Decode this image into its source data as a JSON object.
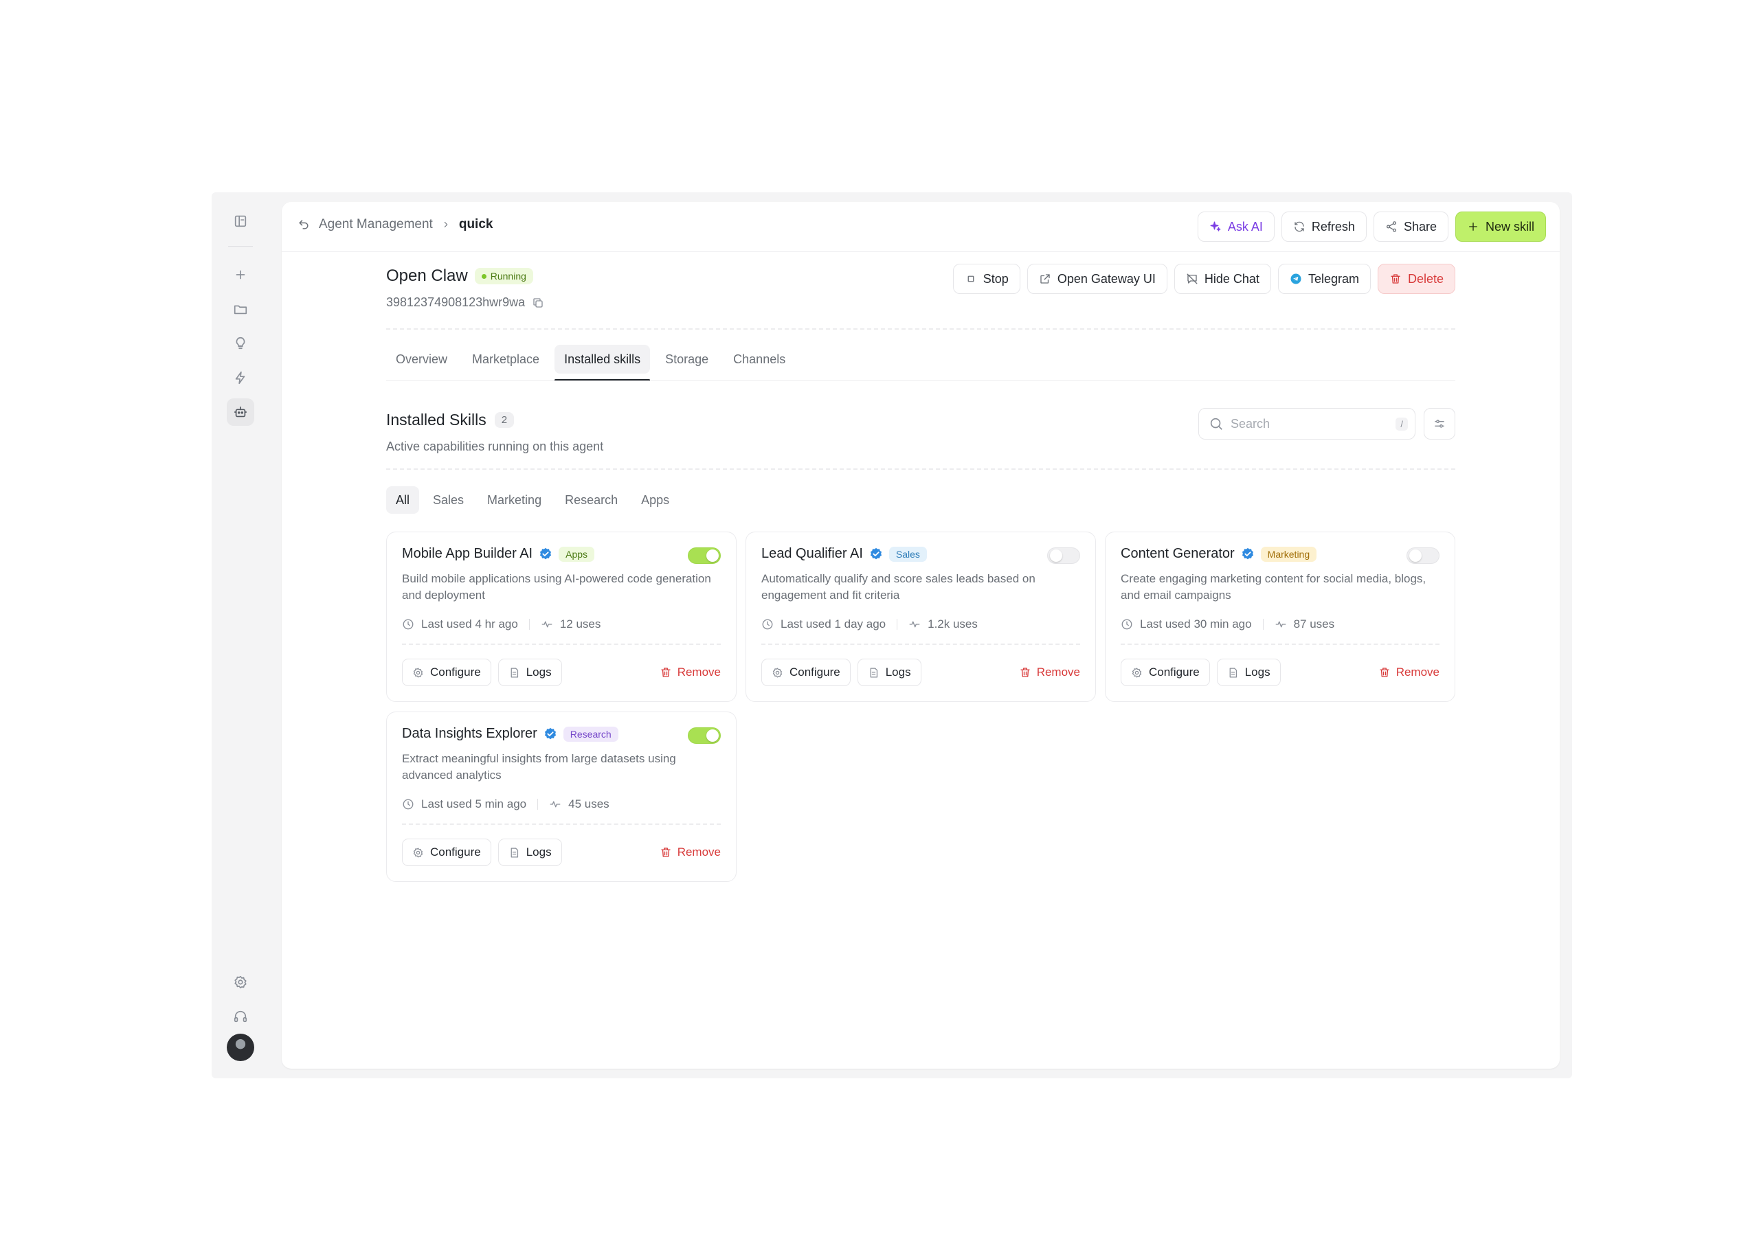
{
  "breadcrumb": {
    "parent": "Agent Management",
    "current": "quick"
  },
  "topbar": {
    "ask_ai": "Ask AI",
    "refresh": "Refresh",
    "share": "Share",
    "new_skill": "New skill"
  },
  "agent": {
    "name": "Open Claw",
    "status": "Running",
    "id": "39812374908123hwr9wa",
    "actions": {
      "stop": "Stop",
      "gateway": "Open Gateway UI",
      "hide_chat": "Hide Chat",
      "telegram": "Telegram",
      "delete": "Delete"
    }
  },
  "tabs": [
    "Overview",
    "Marketplace",
    "Installed skills",
    "Storage",
    "Channels"
  ],
  "active_tab": "Installed skills",
  "section": {
    "title": "Installed Skills",
    "count": "2",
    "subtitle": "Active capabilities running on this agent",
    "search_placeholder": "Search",
    "search_shortcut": "/"
  },
  "filters": [
    "All",
    "Sales",
    "Marketing",
    "Research",
    "Apps"
  ],
  "active_filter": "All",
  "skill_actions": {
    "configure": "Configure",
    "logs": "Logs",
    "remove": "Remove"
  },
  "skills": [
    {
      "name": "Mobile App Builder AI",
      "tag": "Apps",
      "tag_bg": "#eef9dc",
      "tag_color": "#4b7a13",
      "enabled": true,
      "description": "Build mobile applications using AI-powered code generation and deployment",
      "last_used": "Last used 4 hr ago",
      "uses": "12 uses"
    },
    {
      "name": "Lead Qualifier AI",
      "tag": "Sales",
      "tag_bg": "#e3f1fb",
      "tag_color": "#2f7db8",
      "enabled": false,
      "description": "Automatically qualify and score sales leads based on engagement and fit criteria",
      "last_used": "Last used 1 day ago",
      "uses": "1.2k uses"
    },
    {
      "name": "Content Generator",
      "tag": "Marketing",
      "tag_bg": "#fdf1cf",
      "tag_color": "#a2700a",
      "enabled": false,
      "description": "Create engaging marketing content for social media, blogs, and email campaigns",
      "last_used": "Last used 30 min ago",
      "uses": "87 uses"
    },
    {
      "name": "Data Insights Explorer",
      "tag": "Research",
      "tag_bg": "#efe8fb",
      "tag_color": "#7546c9",
      "enabled": true,
      "description": "Extract meaningful insights from large datasets using advanced analytics",
      "last_used": "Last used 5 min ago",
      "uses": "45 uses"
    }
  ],
  "colors": {
    "accent": "#bff06a",
    "danger": "#d83a3a",
    "verified": "#2f8ae0"
  }
}
